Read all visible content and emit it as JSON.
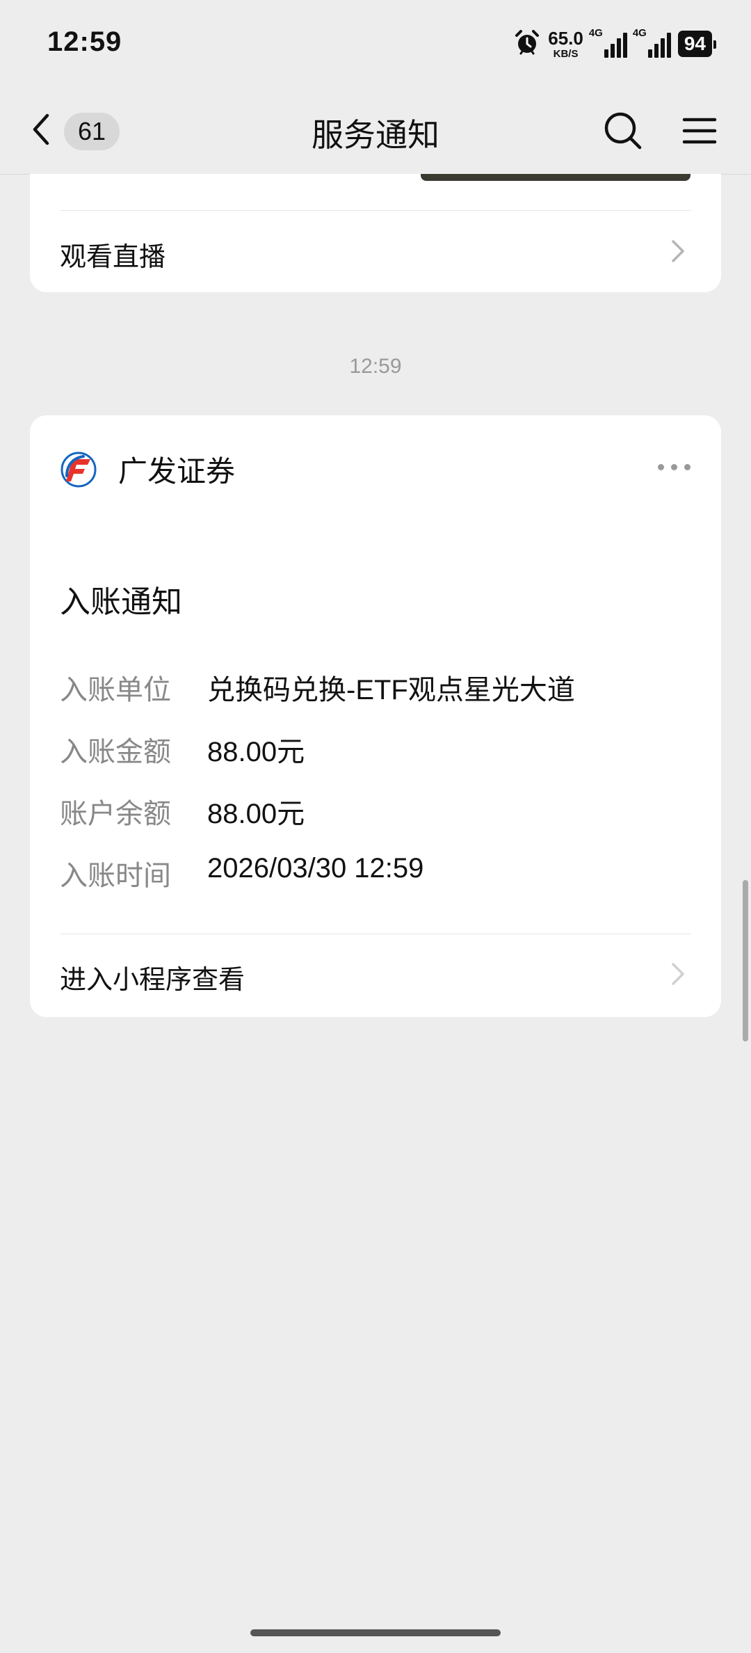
{
  "status_bar": {
    "time": "12:59",
    "net_speed_value": "65.0",
    "net_speed_unit": "KB/S",
    "network_1": "4G",
    "network_2": "4G",
    "battery": "94"
  },
  "nav": {
    "back_count": "61",
    "title": "服务通知"
  },
  "previous_card": {
    "link_label": "观看直播"
  },
  "timestamp": "12:59",
  "notice": {
    "provider": "广发证券",
    "title": "入账通知",
    "fields": [
      {
        "label": "入账单位",
        "value": "兑换码兑换-ETF观点星光大道"
      },
      {
        "label": "入账金额",
        "value": "88.00元"
      },
      {
        "label": "账户余额",
        "value": "88.00元"
      },
      {
        "label": "入账时间",
        "value": "2026/03/30 12:59"
      }
    ],
    "link_label": "进入小程序查看"
  },
  "colors": {
    "background": "#ededed",
    "card": "#ffffff",
    "logo_red": "#e8322b",
    "logo_blue": "#1565c0"
  }
}
